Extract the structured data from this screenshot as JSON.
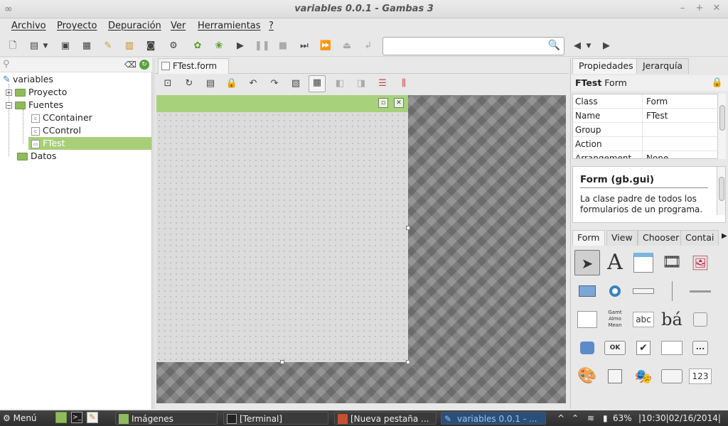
{
  "window": {
    "title": "variables 0.0.1 - Gambas 3",
    "minimize": "–",
    "maximize": "+",
    "close": "✕"
  },
  "menu": [
    "Archivo",
    "Proyecto",
    "Depuración",
    "Ver",
    "Herramientas",
    "?"
  ],
  "search": {
    "placeholder": ""
  },
  "project_tree": {
    "root": "variables",
    "items": [
      {
        "label": "Proyecto",
        "type": "folder",
        "level": 1
      },
      {
        "label": "Fuentes",
        "type": "folder",
        "level": 1
      },
      {
        "label": "CContainer",
        "type": "class",
        "level": 2
      },
      {
        "label": "CControl",
        "type": "class",
        "level": 2
      },
      {
        "label": "FTest",
        "type": "form",
        "level": 2,
        "selected": true
      },
      {
        "label": "Datos",
        "type": "folder",
        "level": 1
      }
    ]
  },
  "editor": {
    "tab_label": "FTest.form"
  },
  "properties": {
    "tabs": [
      "Propiedades",
      "Jerarquía"
    ],
    "header_name": "FTest",
    "header_type": "Form",
    "rows": [
      {
        "key": "Class",
        "value": "Form"
      },
      {
        "key": "Name",
        "value": "FTest"
      },
      {
        "key": "Group",
        "value": ""
      },
      {
        "key": "Action",
        "value": ""
      },
      {
        "key": "Arrangement",
        "value": "None"
      }
    ]
  },
  "help": {
    "title": "Form (gb.gui)",
    "text": "La clase padre de todos los formularios de un programa."
  },
  "palette": {
    "tabs": [
      "Form",
      "View",
      "Chooser",
      "Contai"
    ],
    "items_text": {
      "label_a": "A",
      "textbox": "abc",
      "button": "OK",
      "check": "✔",
      "ellipsis": "...",
      "number": "123",
      "list_1": "Gamt",
      "list_2": "Almo",
      "list_3": "Mean",
      "richtext": "bá"
    }
  },
  "taskbar": {
    "menu": "Menú",
    "items": [
      "Imágenes",
      "[Terminal]",
      "[Nueva pestaña ...",
      "variables 0.0.1 - ..."
    ],
    "battery": "63%",
    "clock": "|10:30|02/16/2014|"
  },
  "colors": {
    "selection": "#a8cf78",
    "form_title": "#a7d17a",
    "taskbar_active": "#2a4f7a"
  }
}
